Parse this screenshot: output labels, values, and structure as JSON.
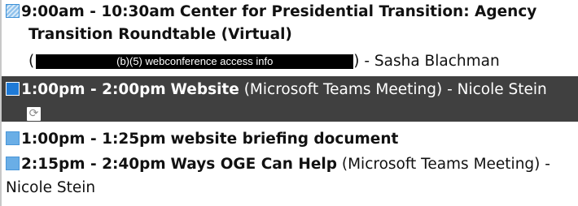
{
  "events": [
    {
      "time": "9:00am - 10:30am",
      "title": "Center for Presidential Transition: Agency",
      "title_cont": "Transition Roundtable (Virtual)",
      "open_paren": "(",
      "redaction": "(b)(5) webconference access info",
      "close_organizer": ") - Sasha Blachman",
      "status": "tentative"
    },
    {
      "time": "1:00pm - 2:00pm",
      "title": "Website",
      "location": "(Microsoft Teams Meeting) - Nicole Stein",
      "recurring_icon": "recurring-icon",
      "status": "selected"
    },
    {
      "time": "1:00pm - 1:25pm",
      "title": "website briefing document",
      "status": "busy"
    },
    {
      "time": "2:15pm - 2:40pm",
      "title": "Ways OGE Can Help",
      "location": "(Microsoft Teams Meeting) -",
      "location_cont": "Nicole Stein",
      "status": "busy"
    }
  ],
  "colors": {
    "selected_background": "#404040",
    "busy_swatch": "#6aaee6",
    "selected_swatch": "#1f7ad6",
    "redaction": "#000000"
  }
}
